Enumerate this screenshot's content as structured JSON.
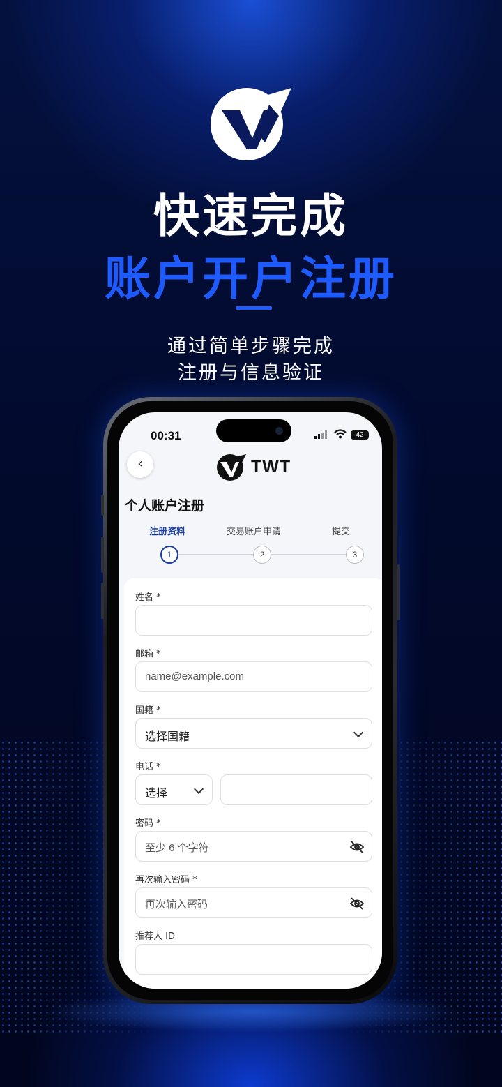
{
  "hero": {
    "title_line1": "快速完成",
    "title_line2": "账户开户注册",
    "subtitle_line1": "通过简单步骤完成",
    "subtitle_line2": "注册与信息验证"
  },
  "status_bar": {
    "time": "00:31",
    "battery": "42"
  },
  "header": {
    "back_icon": "‹",
    "brand": "TWT"
  },
  "page": {
    "title": "个人账户注册"
  },
  "steps": [
    {
      "label": "注册资料",
      "number": "1",
      "active": true
    },
    {
      "label": "交易账户申请",
      "number": "2",
      "active": false
    },
    {
      "label": "提交",
      "number": "3",
      "active": false
    }
  ],
  "form": {
    "name": {
      "label": "姓名 *",
      "placeholder": ""
    },
    "email": {
      "label": "邮箱 *",
      "placeholder": "name@example.com"
    },
    "nationality": {
      "label": "国籍 *",
      "value": "选择国籍"
    },
    "phone": {
      "label": "电话 *",
      "code_value": "选择",
      "placeholder": ""
    },
    "password": {
      "label": "密码 *",
      "placeholder": "至少 6 个字符"
    },
    "password_confirm": {
      "label": "再次输入密码 *",
      "placeholder": "再次输入密码"
    },
    "referrer": {
      "label": "推荐人 ID",
      "placeholder": ""
    }
  },
  "colors": {
    "accent": "#1e5bff",
    "step_active": "#1a3fa0",
    "bg_dark": "#020a2c"
  },
  "icons": [
    "twt-logo-icon",
    "back-icon",
    "signal-icon",
    "wifi-icon",
    "battery-icon",
    "chevron-down-icon",
    "eye-off-icon"
  ]
}
